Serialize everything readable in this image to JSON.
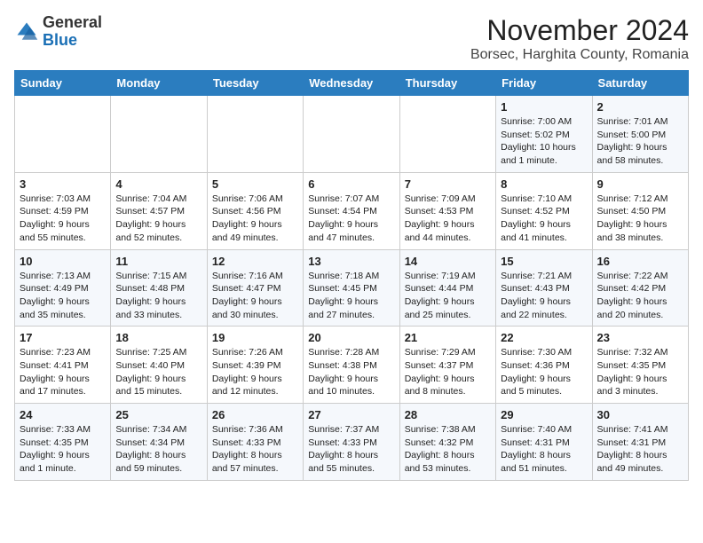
{
  "logo": {
    "general": "General",
    "blue": "Blue"
  },
  "title": "November 2024",
  "subtitle": "Borsec, Harghita County, Romania",
  "weekdays": [
    "Sunday",
    "Monday",
    "Tuesday",
    "Wednesday",
    "Thursday",
    "Friday",
    "Saturday"
  ],
  "weeks": [
    [
      {
        "day": "",
        "info": ""
      },
      {
        "day": "",
        "info": ""
      },
      {
        "day": "",
        "info": ""
      },
      {
        "day": "",
        "info": ""
      },
      {
        "day": "",
        "info": ""
      },
      {
        "day": "1",
        "info": "Sunrise: 7:00 AM\nSunset: 5:02 PM\nDaylight: 10 hours and 1 minute."
      },
      {
        "day": "2",
        "info": "Sunrise: 7:01 AM\nSunset: 5:00 PM\nDaylight: 9 hours and 58 minutes."
      }
    ],
    [
      {
        "day": "3",
        "info": "Sunrise: 7:03 AM\nSunset: 4:59 PM\nDaylight: 9 hours and 55 minutes."
      },
      {
        "day": "4",
        "info": "Sunrise: 7:04 AM\nSunset: 4:57 PM\nDaylight: 9 hours and 52 minutes."
      },
      {
        "day": "5",
        "info": "Sunrise: 7:06 AM\nSunset: 4:56 PM\nDaylight: 9 hours and 49 minutes."
      },
      {
        "day": "6",
        "info": "Sunrise: 7:07 AM\nSunset: 4:54 PM\nDaylight: 9 hours and 47 minutes."
      },
      {
        "day": "7",
        "info": "Sunrise: 7:09 AM\nSunset: 4:53 PM\nDaylight: 9 hours and 44 minutes."
      },
      {
        "day": "8",
        "info": "Sunrise: 7:10 AM\nSunset: 4:52 PM\nDaylight: 9 hours and 41 minutes."
      },
      {
        "day": "9",
        "info": "Sunrise: 7:12 AM\nSunset: 4:50 PM\nDaylight: 9 hours and 38 minutes."
      }
    ],
    [
      {
        "day": "10",
        "info": "Sunrise: 7:13 AM\nSunset: 4:49 PM\nDaylight: 9 hours and 35 minutes."
      },
      {
        "day": "11",
        "info": "Sunrise: 7:15 AM\nSunset: 4:48 PM\nDaylight: 9 hours and 33 minutes."
      },
      {
        "day": "12",
        "info": "Sunrise: 7:16 AM\nSunset: 4:47 PM\nDaylight: 9 hours and 30 minutes."
      },
      {
        "day": "13",
        "info": "Sunrise: 7:18 AM\nSunset: 4:45 PM\nDaylight: 9 hours and 27 minutes."
      },
      {
        "day": "14",
        "info": "Sunrise: 7:19 AM\nSunset: 4:44 PM\nDaylight: 9 hours and 25 minutes."
      },
      {
        "day": "15",
        "info": "Sunrise: 7:21 AM\nSunset: 4:43 PM\nDaylight: 9 hours and 22 minutes."
      },
      {
        "day": "16",
        "info": "Sunrise: 7:22 AM\nSunset: 4:42 PM\nDaylight: 9 hours and 20 minutes."
      }
    ],
    [
      {
        "day": "17",
        "info": "Sunrise: 7:23 AM\nSunset: 4:41 PM\nDaylight: 9 hours and 17 minutes."
      },
      {
        "day": "18",
        "info": "Sunrise: 7:25 AM\nSunset: 4:40 PM\nDaylight: 9 hours and 15 minutes."
      },
      {
        "day": "19",
        "info": "Sunrise: 7:26 AM\nSunset: 4:39 PM\nDaylight: 9 hours and 12 minutes."
      },
      {
        "day": "20",
        "info": "Sunrise: 7:28 AM\nSunset: 4:38 PM\nDaylight: 9 hours and 10 minutes."
      },
      {
        "day": "21",
        "info": "Sunrise: 7:29 AM\nSunset: 4:37 PM\nDaylight: 9 hours and 8 minutes."
      },
      {
        "day": "22",
        "info": "Sunrise: 7:30 AM\nSunset: 4:36 PM\nDaylight: 9 hours and 5 minutes."
      },
      {
        "day": "23",
        "info": "Sunrise: 7:32 AM\nSunset: 4:35 PM\nDaylight: 9 hours and 3 minutes."
      }
    ],
    [
      {
        "day": "24",
        "info": "Sunrise: 7:33 AM\nSunset: 4:35 PM\nDaylight: 9 hours and 1 minute."
      },
      {
        "day": "25",
        "info": "Sunrise: 7:34 AM\nSunset: 4:34 PM\nDaylight: 8 hours and 59 minutes."
      },
      {
        "day": "26",
        "info": "Sunrise: 7:36 AM\nSunset: 4:33 PM\nDaylight: 8 hours and 57 minutes."
      },
      {
        "day": "27",
        "info": "Sunrise: 7:37 AM\nSunset: 4:33 PM\nDaylight: 8 hours and 55 minutes."
      },
      {
        "day": "28",
        "info": "Sunrise: 7:38 AM\nSunset: 4:32 PM\nDaylight: 8 hours and 53 minutes."
      },
      {
        "day": "29",
        "info": "Sunrise: 7:40 AM\nSunset: 4:31 PM\nDaylight: 8 hours and 51 minutes."
      },
      {
        "day": "30",
        "info": "Sunrise: 7:41 AM\nSunset: 4:31 PM\nDaylight: 8 hours and 49 minutes."
      }
    ]
  ]
}
